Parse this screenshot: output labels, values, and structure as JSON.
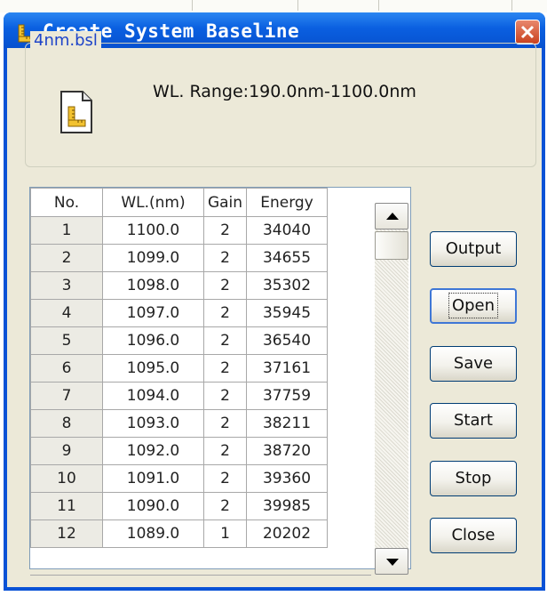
{
  "window": {
    "title": "Create System Baseline",
    "icon": "ruler-icon",
    "accent": "#0a52d6"
  },
  "file_group": {
    "title": "4nm.bsl",
    "range_text": "WL. Range:190.0nm-1100.0nm"
  },
  "table": {
    "columns": [
      "No.",
      "WL.(nm)",
      "Gain",
      "Energy"
    ],
    "rows": [
      [
        "1",
        "1100.0",
        "2",
        "34040"
      ],
      [
        "2",
        "1099.0",
        "2",
        "34655"
      ],
      [
        "3",
        "1098.0",
        "2",
        "35302"
      ],
      [
        "4",
        "1097.0",
        "2",
        "35945"
      ],
      [
        "5",
        "1096.0",
        "2",
        "36540"
      ],
      [
        "6",
        "1095.0",
        "2",
        "37161"
      ],
      [
        "7",
        "1094.0",
        "2",
        "37759"
      ],
      [
        "8",
        "1093.0",
        "2",
        "38211"
      ],
      [
        "9",
        "1092.0",
        "2",
        "38720"
      ],
      [
        "10",
        "1091.0",
        "2",
        "39360"
      ],
      [
        "11",
        "1090.0",
        "2",
        "39985"
      ],
      [
        "12",
        "1089.0",
        "1",
        "20202"
      ]
    ]
  },
  "buttons": {
    "output": "Output",
    "open": "Open",
    "save": "Save",
    "start": "Start",
    "stop": "Stop",
    "close": "Close"
  }
}
